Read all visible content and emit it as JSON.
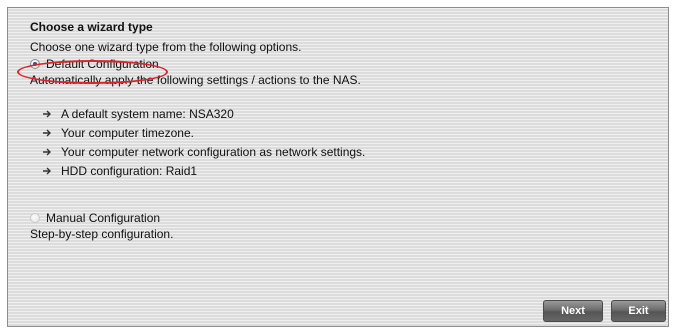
{
  "wizard": {
    "title": "Choose a wizard type",
    "subtitle": "Choose one wizard type from the following options."
  },
  "options": [
    {
      "label": "Default Configuration",
      "selected": true,
      "description": "Automatically apply the following settings / actions to the NAS.",
      "items": [
        "A default system name: NSA320",
        "Your computer timezone.",
        "Your computer network configuration as network settings.",
        "HDD configuration: Raid1"
      ]
    },
    {
      "label": "Manual Configuration",
      "selected": false,
      "description": "Step-by-step configuration."
    }
  ],
  "buttons": {
    "next": "Next",
    "exit": "Exit"
  },
  "colors": {
    "highlight": "#d8262a",
    "radio_dot": "#2d4f9e",
    "button_bg": "#666666"
  },
  "icons": {
    "bullet": "arrow-right-icon"
  }
}
